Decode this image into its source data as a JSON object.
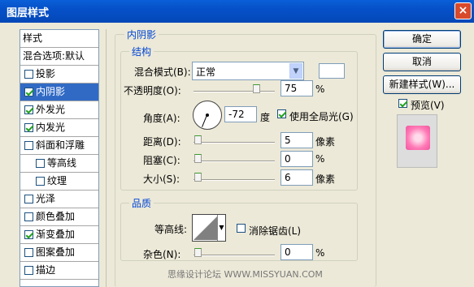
{
  "window": {
    "title": "图层样式",
    "close": "×"
  },
  "left_list": {
    "items": [
      {
        "label": "样式",
        "checked": null
      },
      {
        "label": "混合选项:默认",
        "checked": null
      },
      {
        "label": "投影",
        "checked": false
      },
      {
        "label": "内阴影",
        "checked": true,
        "selected": true
      },
      {
        "label": "外发光",
        "checked": true
      },
      {
        "label": "内发光",
        "checked": true
      },
      {
        "label": "斜面和浮雕",
        "checked": false
      },
      {
        "label": "等高线",
        "checked": false,
        "indent": true
      },
      {
        "label": "纹理",
        "checked": false,
        "indent": true
      },
      {
        "label": "光泽",
        "checked": false
      },
      {
        "label": "颜色叠加",
        "checked": false
      },
      {
        "label": "渐变叠加",
        "checked": true
      },
      {
        "label": "图案叠加",
        "checked": false
      },
      {
        "label": "描边",
        "checked": false
      }
    ]
  },
  "inner_shadow": {
    "section_title": "内阴影",
    "structure_title": "结构",
    "blend_mode_label": "混合模式(B):",
    "blend_mode_value": "正常",
    "opacity_label": "不透明度(O):",
    "opacity_value": "75",
    "opacity_unit": "%",
    "angle_label": "角度(A):",
    "angle_value": "-72",
    "angle_unit": "度",
    "global_light_label": "使用全局光(G)",
    "global_light_checked": true,
    "distance_label": "距离(D):",
    "distance_value": "5",
    "distance_unit": "像素",
    "choke_label": "阻塞(C):",
    "choke_value": "0",
    "choke_unit": "%",
    "size_label": "大小(S):",
    "size_value": "6",
    "size_unit": "像素",
    "quality_title": "品质",
    "contour_label": "等高线:",
    "antialias_label": "消除锯齿(L)",
    "antialias_checked": false,
    "noise_label": "杂色(N):",
    "noise_value": "0",
    "noise_unit": "%"
  },
  "buttons": {
    "ok": "确定",
    "cancel": "取消",
    "new_style": "新建样式(W)...",
    "preview_label": "预览(V)",
    "preview_checked": true
  },
  "watermark": "思缘设计论坛 WWW.MISSYUAN.COM",
  "colors": {
    "title_bar": "#0550c8",
    "selection": "#316ac5",
    "dialog_bg": "#ece9d8",
    "preview_pink": "#ff79b6"
  }
}
